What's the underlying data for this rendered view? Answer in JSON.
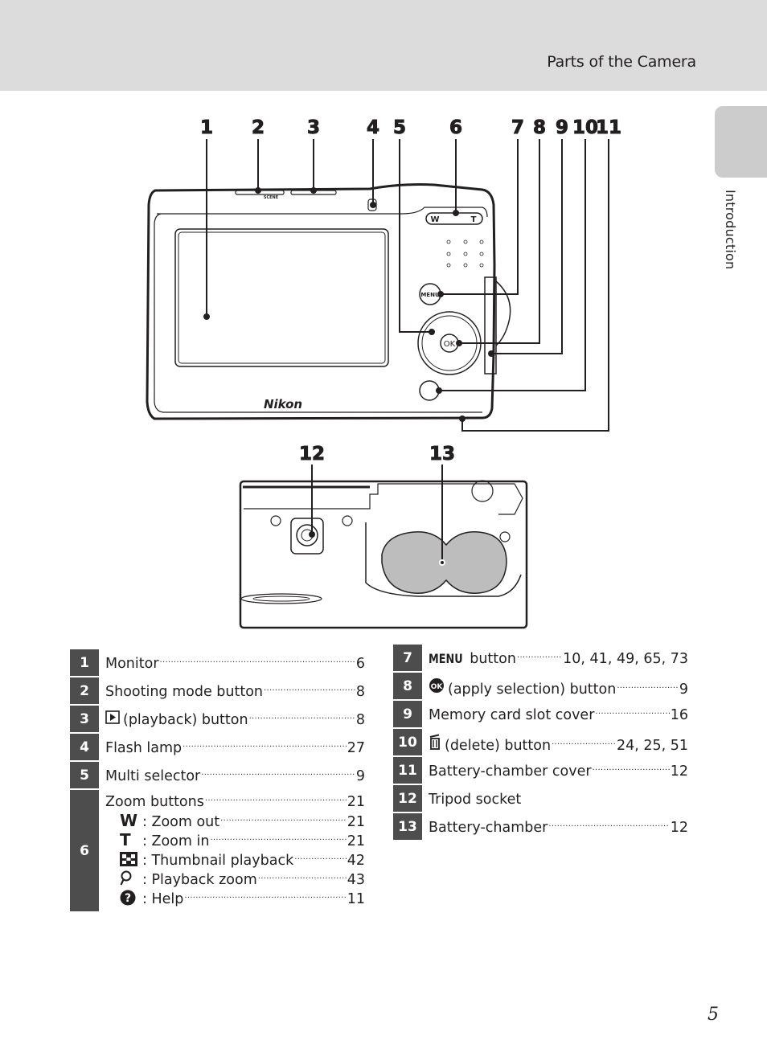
{
  "header": {
    "title": "Parts of the Camera"
  },
  "side_tab": {
    "label": "Introduction"
  },
  "illustration": {
    "back_callouts": [
      "1",
      "2",
      "3",
      "4",
      "5",
      "6",
      "7",
      "8",
      "9",
      "10",
      "11"
    ],
    "bottom_callouts": [
      "12",
      "13"
    ],
    "brand": "Nikon",
    "camera_marks": {
      "zoom_w": "W",
      "zoom_t": "T",
      "menu": "MENU",
      "ok": "OK",
      "scene": "SCENE"
    }
  },
  "parts_left": [
    {
      "num": "1",
      "label": "Monitor",
      "page": "6"
    },
    {
      "num": "2",
      "label": "Shooting mode button",
      "page": "8"
    },
    {
      "num": "3",
      "icon": "playback-icon",
      "label": "(playback) button",
      "page": "8"
    },
    {
      "num": "4",
      "label": "Flash lamp",
      "page": "27"
    },
    {
      "num": "5",
      "label": "Multi selector",
      "page": "9"
    },
    {
      "num": "6",
      "label": "Zoom buttons",
      "page": "21",
      "sub": [
        {
          "glyph": "W",
          "icon": "zoom-wide-icon",
          "label": ": Zoom out",
          "page": "21"
        },
        {
          "glyph": "T",
          "icon": "zoom-tele-icon",
          "label": ": Zoom in",
          "page": "21"
        },
        {
          "glyph": "",
          "icon": "thumbnail-icon",
          "label": ": Thumbnail playback",
          "page": "42"
        },
        {
          "glyph": "",
          "icon": "magnifier-icon",
          "label": ": Playback zoom",
          "page": "43"
        },
        {
          "glyph": "",
          "icon": "help-icon",
          "label": ": Help",
          "page": "11"
        }
      ]
    }
  ],
  "parts_right": [
    {
      "num": "7",
      "icon": "menu-icon",
      "icon_text": "MENU",
      "label": "button",
      "page": "10, 41, 49, 65, 73"
    },
    {
      "num": "8",
      "icon": "ok-icon",
      "icon_text": "OK",
      "label": "(apply selection) button",
      "page": "9"
    },
    {
      "num": "9",
      "label": "Memory card slot cover",
      "page": "16"
    },
    {
      "num": "10",
      "icon": "trash-icon",
      "label": "(delete) button",
      "page": "24, 25, 51"
    },
    {
      "num": "11",
      "label": "Battery-chamber cover",
      "page": "12"
    },
    {
      "num": "12",
      "label": "Tripod socket",
      "page": ""
    },
    {
      "num": "13",
      "label": "Battery-chamber",
      "page": "12"
    }
  ],
  "page_number": "5",
  "colors": {
    "header_band": "#dcdcdc",
    "side_tab": "#cccccc",
    "badge": "#4d4d4d",
    "text": "#231f20"
  }
}
